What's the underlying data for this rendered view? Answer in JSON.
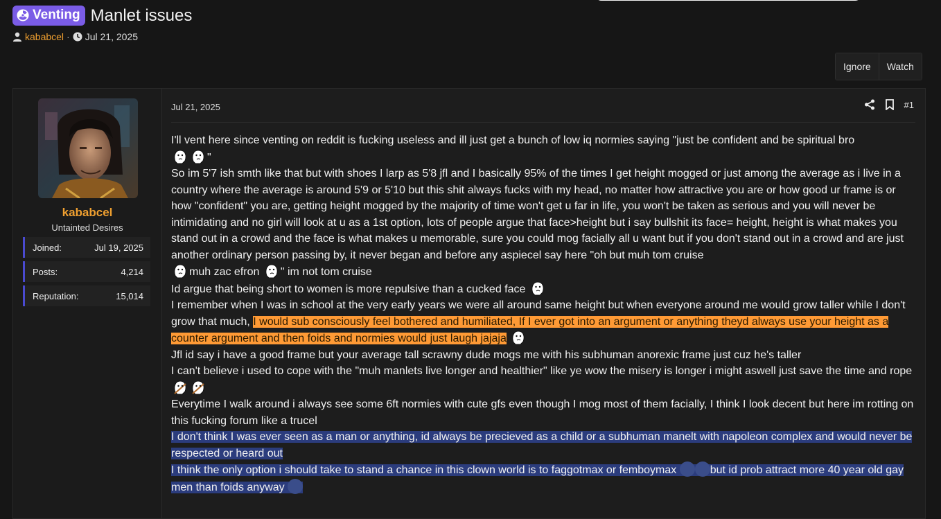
{
  "thread": {
    "prefix": "Venting",
    "title": "Manlet issues",
    "author": "kababcel",
    "separator": "·",
    "date": "Jul 21, 2025"
  },
  "thread_actions": {
    "ignore": "Ignore",
    "watch": "Watch"
  },
  "user": {
    "name": "kababcel",
    "title": "Untainted Desires",
    "stats": [
      {
        "label": "Joined:",
        "value": "Jul 19, 2025"
      },
      {
        "label": "Posts:",
        "value": "4,214"
      },
      {
        "label": "Reputation:",
        "value": "15,014"
      }
    ]
  },
  "post": {
    "date": "Jul 21, 2025",
    "number": "#1",
    "l1": "I'll vent here since venting on reddit is fucking useless and ill just get a bunch of low iq normies saying \"just be confident and be spiritual bro",
    "l1_end": "\"",
    "l2": "So im 5'7 ish smth like that but with shoes I larp as 5'8 jfl and I basically 95% of the times I get height mogged or just among the average as i live in a country where the average is around 5'9 or 5'10 but this shit always fucks with my head, no matter how attractive you are or how good ur frame is or how \"confident\" you are, getting height mogged by the majority of time won't get u far in life, you won't be taken as serious and you will never be intimidating and no girl will look at u as a 1st option, lots of people argue that face>height but i say bullshit its face= height, height is what makes you stand out in a crowd and the face is what makes u memorable, sure you could mog facially all u want but if you don't stand out in a crowd and are just another ordinary person passing by, it never began and before any aspiecel say here \"oh but muh tom cruise",
    "l2_mid": "muh zac efron",
    "l2_end": "\" im not tom cruise",
    "l3": "Id argue that being short to women is more repulsive than a cucked face",
    "l4": "I remember when I was in school at the very early years we were all around same height but when everyone around me would grow taller while I don't grow that much,",
    "l4_hl": "I would sub consciously feel bothered and humiliated, If I ever got into an argument or anything theyd always use your height as a counter argument and then foids and normies would just laugh jajaja",
    "l5": "Jfl id say i have a good frame but your average tall scrawny dude mogs me with his subhuman anorexic frame just cuz he's taller",
    "l6": "I can't believe i used to cope with the \"muh manlets live longer and healthier\" like ye wow the misery is longer i might aswell just save the time and rope",
    "l7": "Everytime I walk around i always see some 6ft normies with cute gfs even though I mog most of them facially, I think I look decent but here im rotting on this fucking forum like a trucel",
    "l8_hl": "I don't think I was ever seen as a man or anything, id always be precieved as a child or a subhuman manelt with napoleon complex and would never be respected or heard out",
    "l9_hl": "I think the only option i should take to stand a chance in this clown world is to faggotmax or femboymax",
    "l9_hl_end": "but id prob attract more 40 year old gay men than foids anyway"
  },
  "colors": {
    "prefix_bg": "#7a5ce6",
    "username": "#f0a030",
    "highlight_orange": "#ff9a35",
    "highlight_blue": "#2b3c7d",
    "stat_accent": "#4a4ad0"
  },
  "icons": [
    "radiation-icon",
    "user-icon",
    "clock-icon",
    "share-icon",
    "bookmark-icon",
    "pepe-emoji-icon",
    "wojak-emoji-icon",
    "rope-emoji-icon",
    "sad-emoji-icon"
  ]
}
